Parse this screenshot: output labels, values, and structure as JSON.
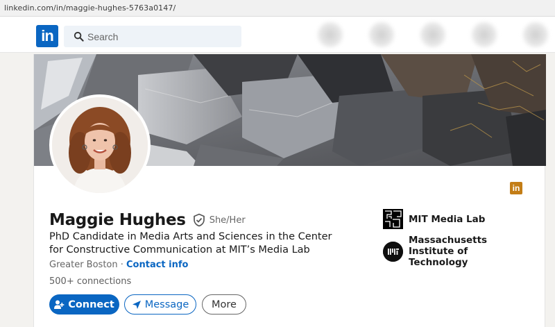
{
  "browser": {
    "url": "linkedin.com/in/maggie-hughes-5763a0147/"
  },
  "nav": {
    "logo_text": "in",
    "search_placeholder": "Search",
    "icons": [
      "search-icon"
    ]
  },
  "profile": {
    "name": "Maggie Hughes",
    "pronouns": "She/Her",
    "headline": "PhD Candidate in Media Arts and Sciences in the Center for Constructive Communication at MIT’s Media Lab",
    "location": "Greater Boston",
    "separator": " · ",
    "contact_info_label": "Contact info",
    "connections": "500+ connections",
    "badge_text": "in"
  },
  "actions": {
    "connect_label": "Connect",
    "message_label": "Message",
    "more_label": "More"
  },
  "experience": [
    {
      "name": "MIT Media Lab"
    },
    {
      "name": "Massachusetts Institute of Technology"
    }
  ],
  "colors": {
    "brand": "#0a66c2",
    "premium_badge": "#c37d16"
  }
}
